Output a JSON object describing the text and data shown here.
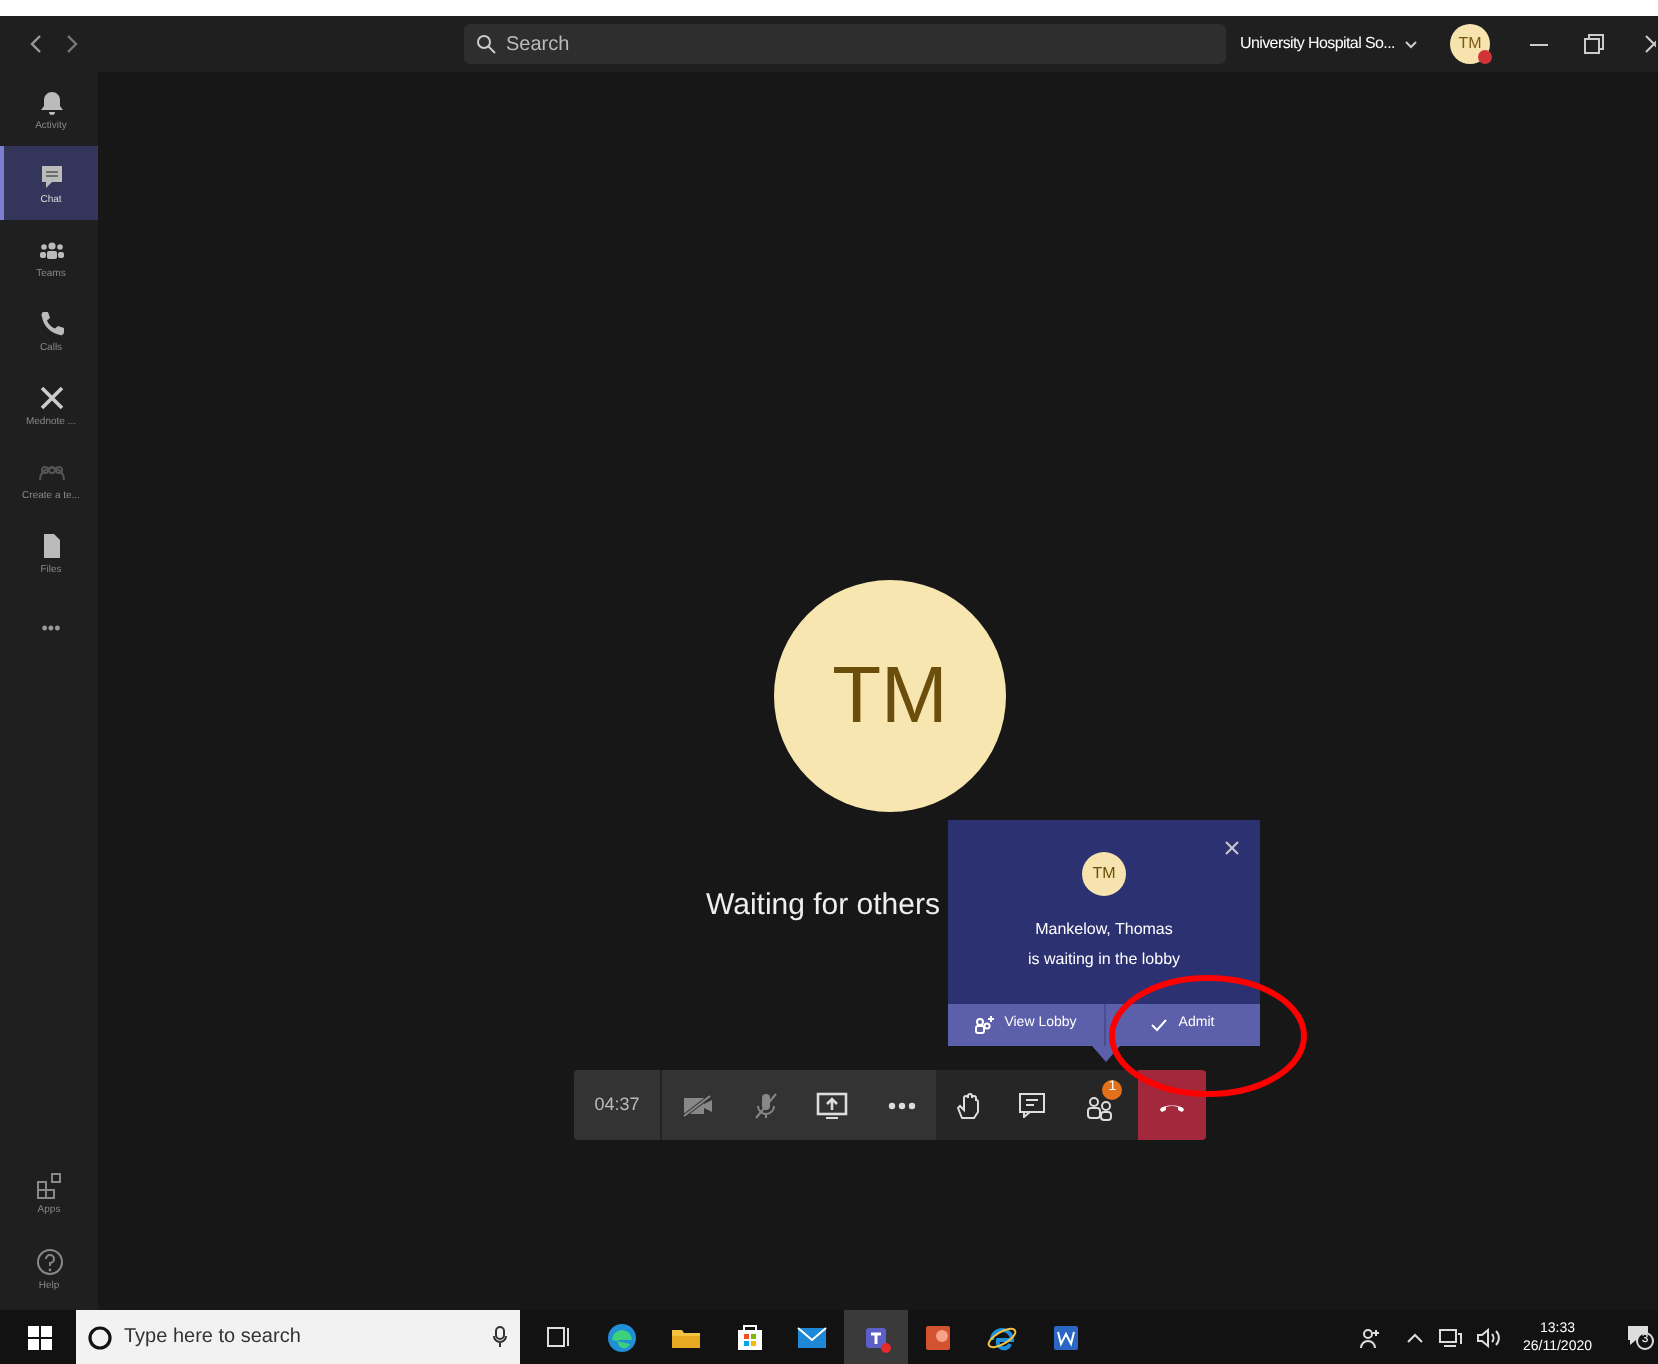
{
  "title_bar": {
    "search_placeholder": "Search",
    "organization": "University Hospital So...",
    "avatar_initials": "TM"
  },
  "sidebar": {
    "items": [
      {
        "label": "Activity",
        "kind": "bell",
        "selected": false
      },
      {
        "label": "Chat",
        "kind": "chat",
        "selected": true
      },
      {
        "label": "Teams",
        "kind": "teams",
        "selected": false
      },
      {
        "label": "Calls",
        "kind": "phone",
        "selected": false
      },
      {
        "label": "Mednote ...",
        "kind": "x",
        "selected": false
      },
      {
        "label": "Create a te...",
        "kind": "people",
        "selected": false
      },
      {
        "label": "Files",
        "kind": "file",
        "selected": false
      },
      {
        "label": "•••",
        "kind": "more",
        "selected": false
      }
    ],
    "bottom_items": [
      {
        "label": "Apps",
        "kind": "apps"
      },
      {
        "label": "Help",
        "kind": "help"
      }
    ]
  },
  "stage": {
    "avatar_initials": "TM",
    "message": "Waiting for others"
  },
  "lobby_popup": {
    "avatar_initials": "TM",
    "name": "Mankelow, Thomas",
    "message": "is waiting in the lobby",
    "buttons": [
      {
        "label": "View Lobby",
        "kind": "lobby"
      },
      {
        "label": "Admit",
        "kind": "admit"
      }
    ]
  },
  "call_bar": {
    "timer": "04:37",
    "participants_badge": "1"
  },
  "annotation": {
    "kind": "ellipse",
    "color": "#ff0000"
  },
  "taskbar": {
    "search_placeholder": "Type here to search",
    "apps": [
      {
        "kind": "taskview",
        "active": false
      },
      {
        "kind": "edge",
        "active": false
      },
      {
        "kind": "folder",
        "active": false
      },
      {
        "kind": "store",
        "active": false
      },
      {
        "kind": "mail",
        "active": false
      },
      {
        "kind": "teams",
        "active": true
      },
      {
        "kind": "powerpoint",
        "active": false
      },
      {
        "kind": "ie",
        "active": false
      },
      {
        "kind": "word",
        "active": false
      }
    ],
    "time": "13:33",
    "date": "26/11/2020",
    "notification_count": "3"
  }
}
